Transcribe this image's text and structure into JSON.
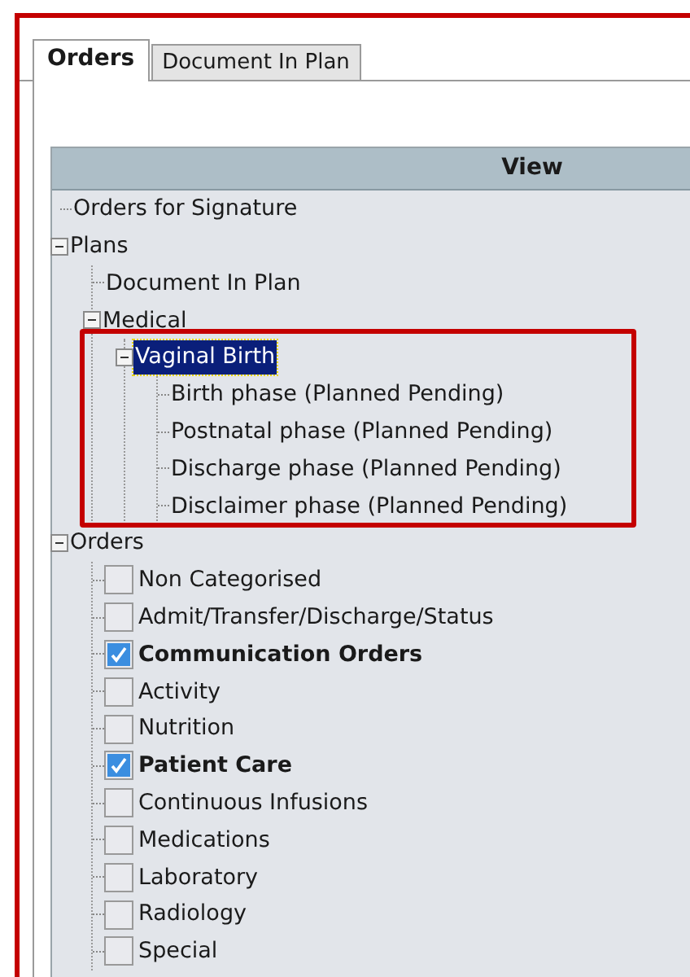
{
  "tabs": [
    {
      "label": "Orders",
      "selected": true
    },
    {
      "label": "Document In Plan",
      "selected": false
    }
  ],
  "view": {
    "header": "View",
    "tree": [
      {
        "kind": "leaf",
        "label": "Orders for Signature",
        "selected": false
      },
      {
        "kind": "folder",
        "label": "Plans",
        "expanded": true,
        "selected": false,
        "children": [
          {
            "kind": "leaf",
            "label": "Document In Plan",
            "selected": false
          },
          {
            "kind": "folder",
            "label": "Medical",
            "expanded": true,
            "selected": false,
            "children": [
              {
                "kind": "folder",
                "label": "Vaginal Birth",
                "expanded": true,
                "selected": true,
                "highlighted": true,
                "children": [
                  {
                    "kind": "leaf",
                    "label": "Birth phase (Planned Pending)",
                    "selected": false
                  },
                  {
                    "kind": "leaf",
                    "label": "Postnatal phase (Planned Pending)",
                    "selected": false
                  },
                  {
                    "kind": "leaf",
                    "label": "Discharge phase (Planned Pending)",
                    "selected": false
                  },
                  {
                    "kind": "leaf",
                    "label": "Disclaimer phase (Planned Pending)",
                    "selected": false
                  }
                ]
              }
            ]
          }
        ]
      },
      {
        "kind": "folder",
        "label": "Orders",
        "expanded": true,
        "selected": false,
        "children": [
          {
            "kind": "check",
            "label": "Non Categorised",
            "checked": false,
            "selected": false
          },
          {
            "kind": "check",
            "label": "Admit/Transfer/Discharge/Status",
            "checked": false,
            "selected": false
          },
          {
            "kind": "check",
            "label": "Communication Orders",
            "checked": true,
            "selected": false
          },
          {
            "kind": "check",
            "label": "Activity",
            "checked": false,
            "selected": false
          },
          {
            "kind": "check",
            "label": "Nutrition",
            "checked": false,
            "selected": false
          },
          {
            "kind": "check",
            "label": "Patient Care",
            "checked": true,
            "selected": false
          },
          {
            "kind": "check",
            "label": "Continuous Infusions",
            "checked": false,
            "selected": false
          },
          {
            "kind": "check",
            "label": "Medications",
            "checked": false,
            "selected": false
          },
          {
            "kind": "check",
            "label": "Laboratory",
            "checked": false,
            "selected": false
          },
          {
            "kind": "check",
            "label": "Radiology",
            "checked": false,
            "selected": false
          },
          {
            "kind": "check",
            "label": "Special",
            "checked": false,
            "selected": false
          }
        ]
      }
    ]
  }
}
